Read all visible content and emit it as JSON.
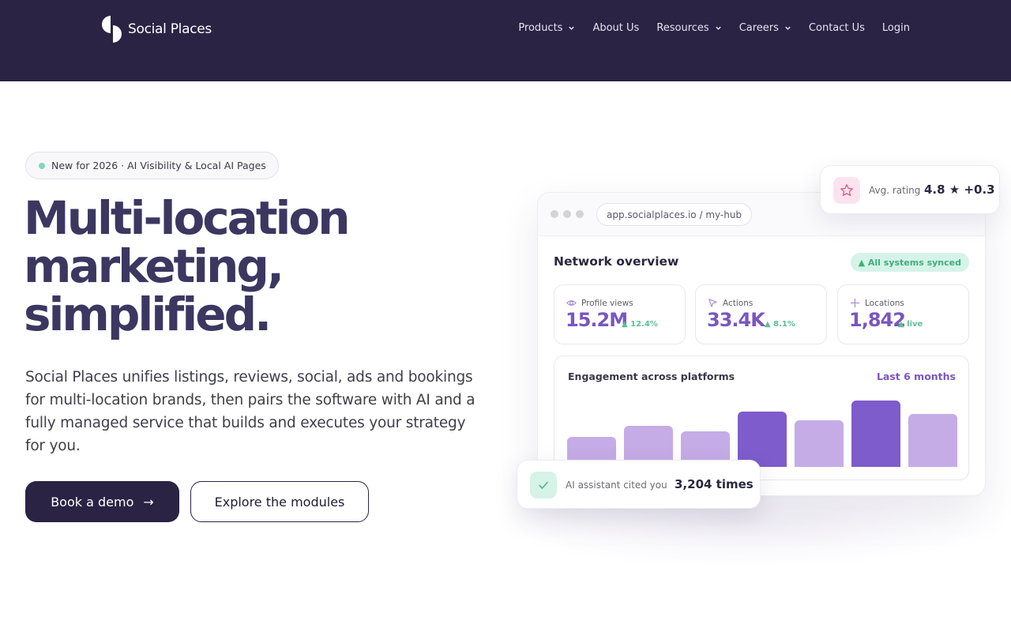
{
  "colors": {
    "nav_bg": "#2a2344",
    "headline": "#3c3760",
    "accent_purple": "#7a56c0",
    "bar_light": "#c5ace6",
    "bar_dark": "#7e5ccb",
    "success_green": "#5cc196"
  },
  "header": {
    "logo_text": "Social Places",
    "logo_icon": "social-places-logo",
    "nav": [
      {
        "label": "Products",
        "has_dropdown": true
      },
      {
        "label": "About Us",
        "has_dropdown": false
      },
      {
        "label": "Resources",
        "has_dropdown": true
      },
      {
        "label": "Careers",
        "has_dropdown": true
      },
      {
        "label": "Contact Us",
        "has_dropdown": false
      },
      {
        "label": "Login",
        "has_dropdown": false
      }
    ]
  },
  "hero": {
    "badge": "New for 2026 · AI Visibility & Local AI Pages",
    "headline_lines": [
      "Multi-location",
      "marketing,",
      "simplified."
    ],
    "subcopy": "Social Places unifies listings, reviews, social, ads and bookings for multi-location brands, then pairs the software with AI and a fully managed service that builds and executes your strategy for you.",
    "primary_cta": "Book a demo",
    "primary_cta_arrow": "→",
    "secondary_cta": "Explore the modules"
  },
  "dashboard": {
    "url": "app.socialplaces.io / my-hub",
    "title": "Network overview",
    "sync_status": "▲ All systems synced",
    "stats": [
      {
        "icon": "eye-icon",
        "label": "Profile views",
        "value": "15.2M",
        "delta": "▲ 12.4%"
      },
      {
        "icon": "cursor-icon",
        "label": "Actions",
        "value": "33.4K",
        "delta": "▲ 8.1%"
      },
      {
        "icon": "plus-icon",
        "label": "Locations",
        "value": "1,842",
        "delta": "▲ live"
      }
    ],
    "engagement": {
      "title": "Engagement across platforms",
      "range": "Last 6 months",
      "bar_levels": [
        0.42,
        0.58,
        0.5,
        0.78,
        0.66,
        0.93,
        0.75
      ],
      "bar_highlight": [
        false,
        false,
        false,
        true,
        false,
        true,
        false
      ]
    }
  },
  "rating_card": {
    "label": "Avg. rating",
    "value": "4.8 ★ +0.3",
    "icon": "star-icon"
  },
  "ai_card": {
    "label": "AI assistant cited you",
    "value": "3,204 times",
    "icon": "check-icon"
  }
}
